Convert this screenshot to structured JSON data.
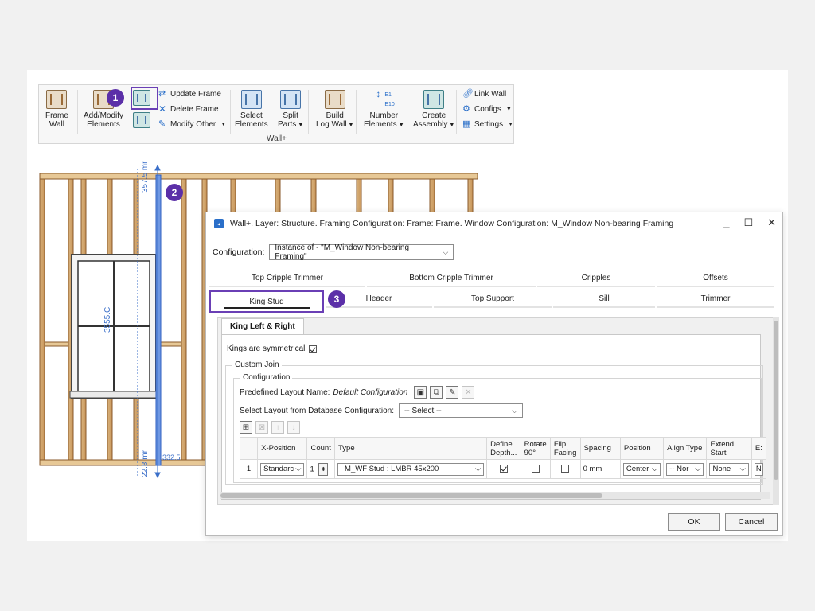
{
  "ribbon": {
    "frame_wall": "Frame\nWall",
    "frame_wall_1": "Frame",
    "frame_wall_2": "Wall",
    "add_modify_1": "Add/Modify",
    "add_modify_2": "Elements",
    "update_frame": "Update Frame",
    "delete_frame": "Delete Frame",
    "modify_other": "Modify Other",
    "select_1": "Select",
    "select_2": "Elements",
    "split_1": "Split",
    "split_2": "Parts",
    "build_1": "Build",
    "build_2": "Log Wall",
    "number_1": "Number",
    "number_2": "Elements",
    "number_icon_top": "E1",
    "number_icon_bottom": "E10",
    "create_1": "Create",
    "create_2": "Assembly",
    "link_wall": "Link Wall",
    "configs": "Configs",
    "settings": "Settings",
    "group_label": "Wall+"
  },
  "callouts": {
    "one": "1",
    "two": "2",
    "three": "3"
  },
  "drawing": {
    "dim_top": "357.5 mr",
    "dim_mid": "3555.C",
    "dim_bottom": "22.8 mr",
    "dim_right": "332.5"
  },
  "dialog": {
    "title": "Wall+. Layer: Structure. Framing Configuration: Frame: Frame. Window Configuration: M_Window Non-bearing Framing",
    "configuration_label": "Configuration:",
    "configuration_value": "Instance of - \"M_Window Non-bearing Framing\"",
    "tabs_row1": [
      "Top Cripple Trimmer",
      "Bottom Cripple Trimmer",
      "Cripples",
      "Offsets"
    ],
    "tabs_row2": [
      "King Stud",
      "Header",
      "Top Support",
      "Sill",
      "Trimmer"
    ],
    "subtab": "King Left & Right",
    "kings_symmetrical_label": "Kings are symmetrical",
    "kings_symmetrical_checked": true,
    "custom_join": "Custom Join",
    "configuration_group": "Configuration",
    "predefined_label": "Predefined Layout Name:",
    "predefined_value": "Default Configuration",
    "select_layout_label": "Select Layout from Database Configuration:",
    "select_layout_value": "-- Select --",
    "grid": {
      "headers": [
        "",
        "X-Position",
        "Count",
        "Type",
        "Define Depth...",
        "Rotate 90°",
        "Flip Facing",
        "Spacing",
        "Position",
        "Align Type",
        "Extend Start",
        "E:"
      ],
      "rows": [
        {
          "index": "1",
          "x_position": "Standarc",
          "count": "1",
          "type": "M_WF Stud : LMBR 45x200",
          "define_depth": true,
          "rotate90": false,
          "flip_facing": false,
          "spacing": "0 mm",
          "position": "Center",
          "align_type": "-- Nor",
          "extend_start": "None",
          "extend_end": "N"
        }
      ]
    },
    "ok": "OK",
    "cancel": "Cancel"
  }
}
